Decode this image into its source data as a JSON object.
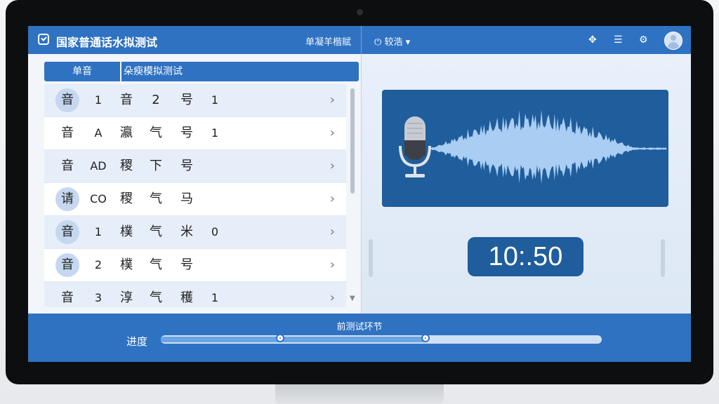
{
  "app": {
    "title": "国家普通话水拟测试",
    "mode_label": "单凝羊楷赋",
    "user_menu_label": "较浩",
    "icons": [
      "move-icon",
      "list-icon",
      "settings-icon",
      "user-avatar"
    ]
  },
  "tabs": [
    {
      "label": "单音",
      "active": true
    },
    {
      "label": "朵瘐模拟测试",
      "active": false
    }
  ],
  "list": {
    "rows": [
      {
        "cells": [
          "音",
          "1",
          "音",
          "2",
          "号",
          "1"
        ],
        "badge": true
      },
      {
        "cells": [
          "音",
          "A",
          "瀛",
          "气",
          "号",
          "1"
        ],
        "badge": false
      },
      {
        "cells": [
          "音",
          "AD",
          "稷",
          "下",
          "号",
          ""
        ],
        "badge": false
      },
      {
        "cells": [
          "请",
          "CO",
          "稷",
          "气",
          "马",
          ""
        ],
        "badge": true
      },
      {
        "cells": [
          "音",
          "1",
          "樸",
          "气",
          "米",
          "0"
        ],
        "badge": true
      },
      {
        "cells": [
          "音",
          "2",
          "樸",
          "气",
          "号",
          ""
        ],
        "badge": true
      },
      {
        "cells": [
          "音",
          "3",
          "淳",
          "气",
          "穫",
          "1"
        ],
        "badge": false
      }
    ]
  },
  "timer": {
    "value": "10:.50"
  },
  "footer": {
    "stage_title": "前测试环节",
    "progress_label": "进度",
    "progress_fraction": 0.6,
    "marker_fractions": [
      0.27,
      0.6
    ]
  },
  "colors": {
    "accent": "#2f72c2",
    "wave_bg": "#1f5d9c",
    "wave": "#a9cdf3"
  }
}
